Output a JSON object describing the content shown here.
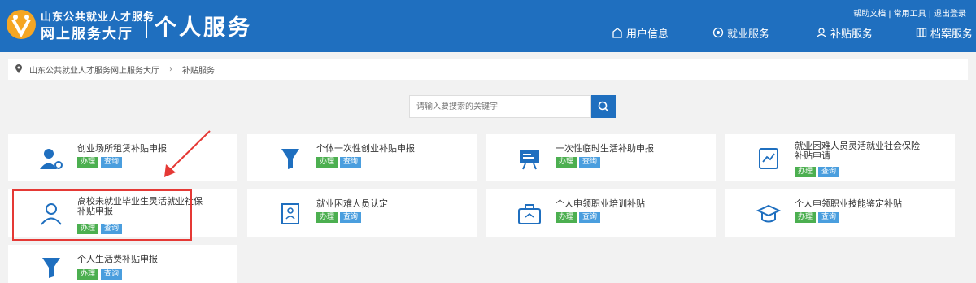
{
  "header": {
    "org_line1": "山东公共就业人才服务",
    "org_line2": "网上服务大厅",
    "portal_title": "个人服务",
    "top_links": [
      "帮助文档",
      "常用工具",
      "退出登录"
    ]
  },
  "nav": [
    {
      "label": "用户信息",
      "icon": "user-info-icon"
    },
    {
      "label": "就业服务",
      "icon": "employment-icon"
    },
    {
      "label": "补贴服务",
      "icon": "subsidy-icon"
    },
    {
      "label": "档案服务",
      "icon": "archive-icon"
    }
  ],
  "breadcrumb": {
    "home": "山东公共就业人才服务网上服务大厅",
    "separator": "›",
    "current": "补贴服务"
  },
  "search": {
    "placeholder": "请输入要搜索的关键字"
  },
  "badges": {
    "do": "办理",
    "query": "查询"
  },
  "services": [
    {
      "label": "创业场所租赁补贴申报",
      "icon": "person-wrench-icon"
    },
    {
      "label": "个体一次性创业补贴申报",
      "icon": "funnel-icon"
    },
    {
      "label": "一次性临时生活补助申报",
      "icon": "presentation-board-icon"
    },
    {
      "label": "就业困难人员灵活就业社会保险补贴申请",
      "icon": "document-chart-icon"
    },
    {
      "label": "高校未就业毕业生灵活就业社保补贴申报",
      "icon": "person-outline-icon"
    },
    {
      "label": "就业困难人员认定",
      "icon": "id-card-icon"
    },
    {
      "label": "个人申领职业培训补贴",
      "icon": "briefcase-icon"
    },
    {
      "label": "个人申领职业技能鉴定补贴",
      "icon": "graduation-cap-icon"
    },
    {
      "label": "个人生活费补贴申报",
      "icon": "funnel-icon"
    }
  ],
  "colors": {
    "header_bg": "#1f6fbf",
    "badge_do": "#4caf50",
    "badge_query": "#4a9ede",
    "highlight": "#e53935"
  }
}
